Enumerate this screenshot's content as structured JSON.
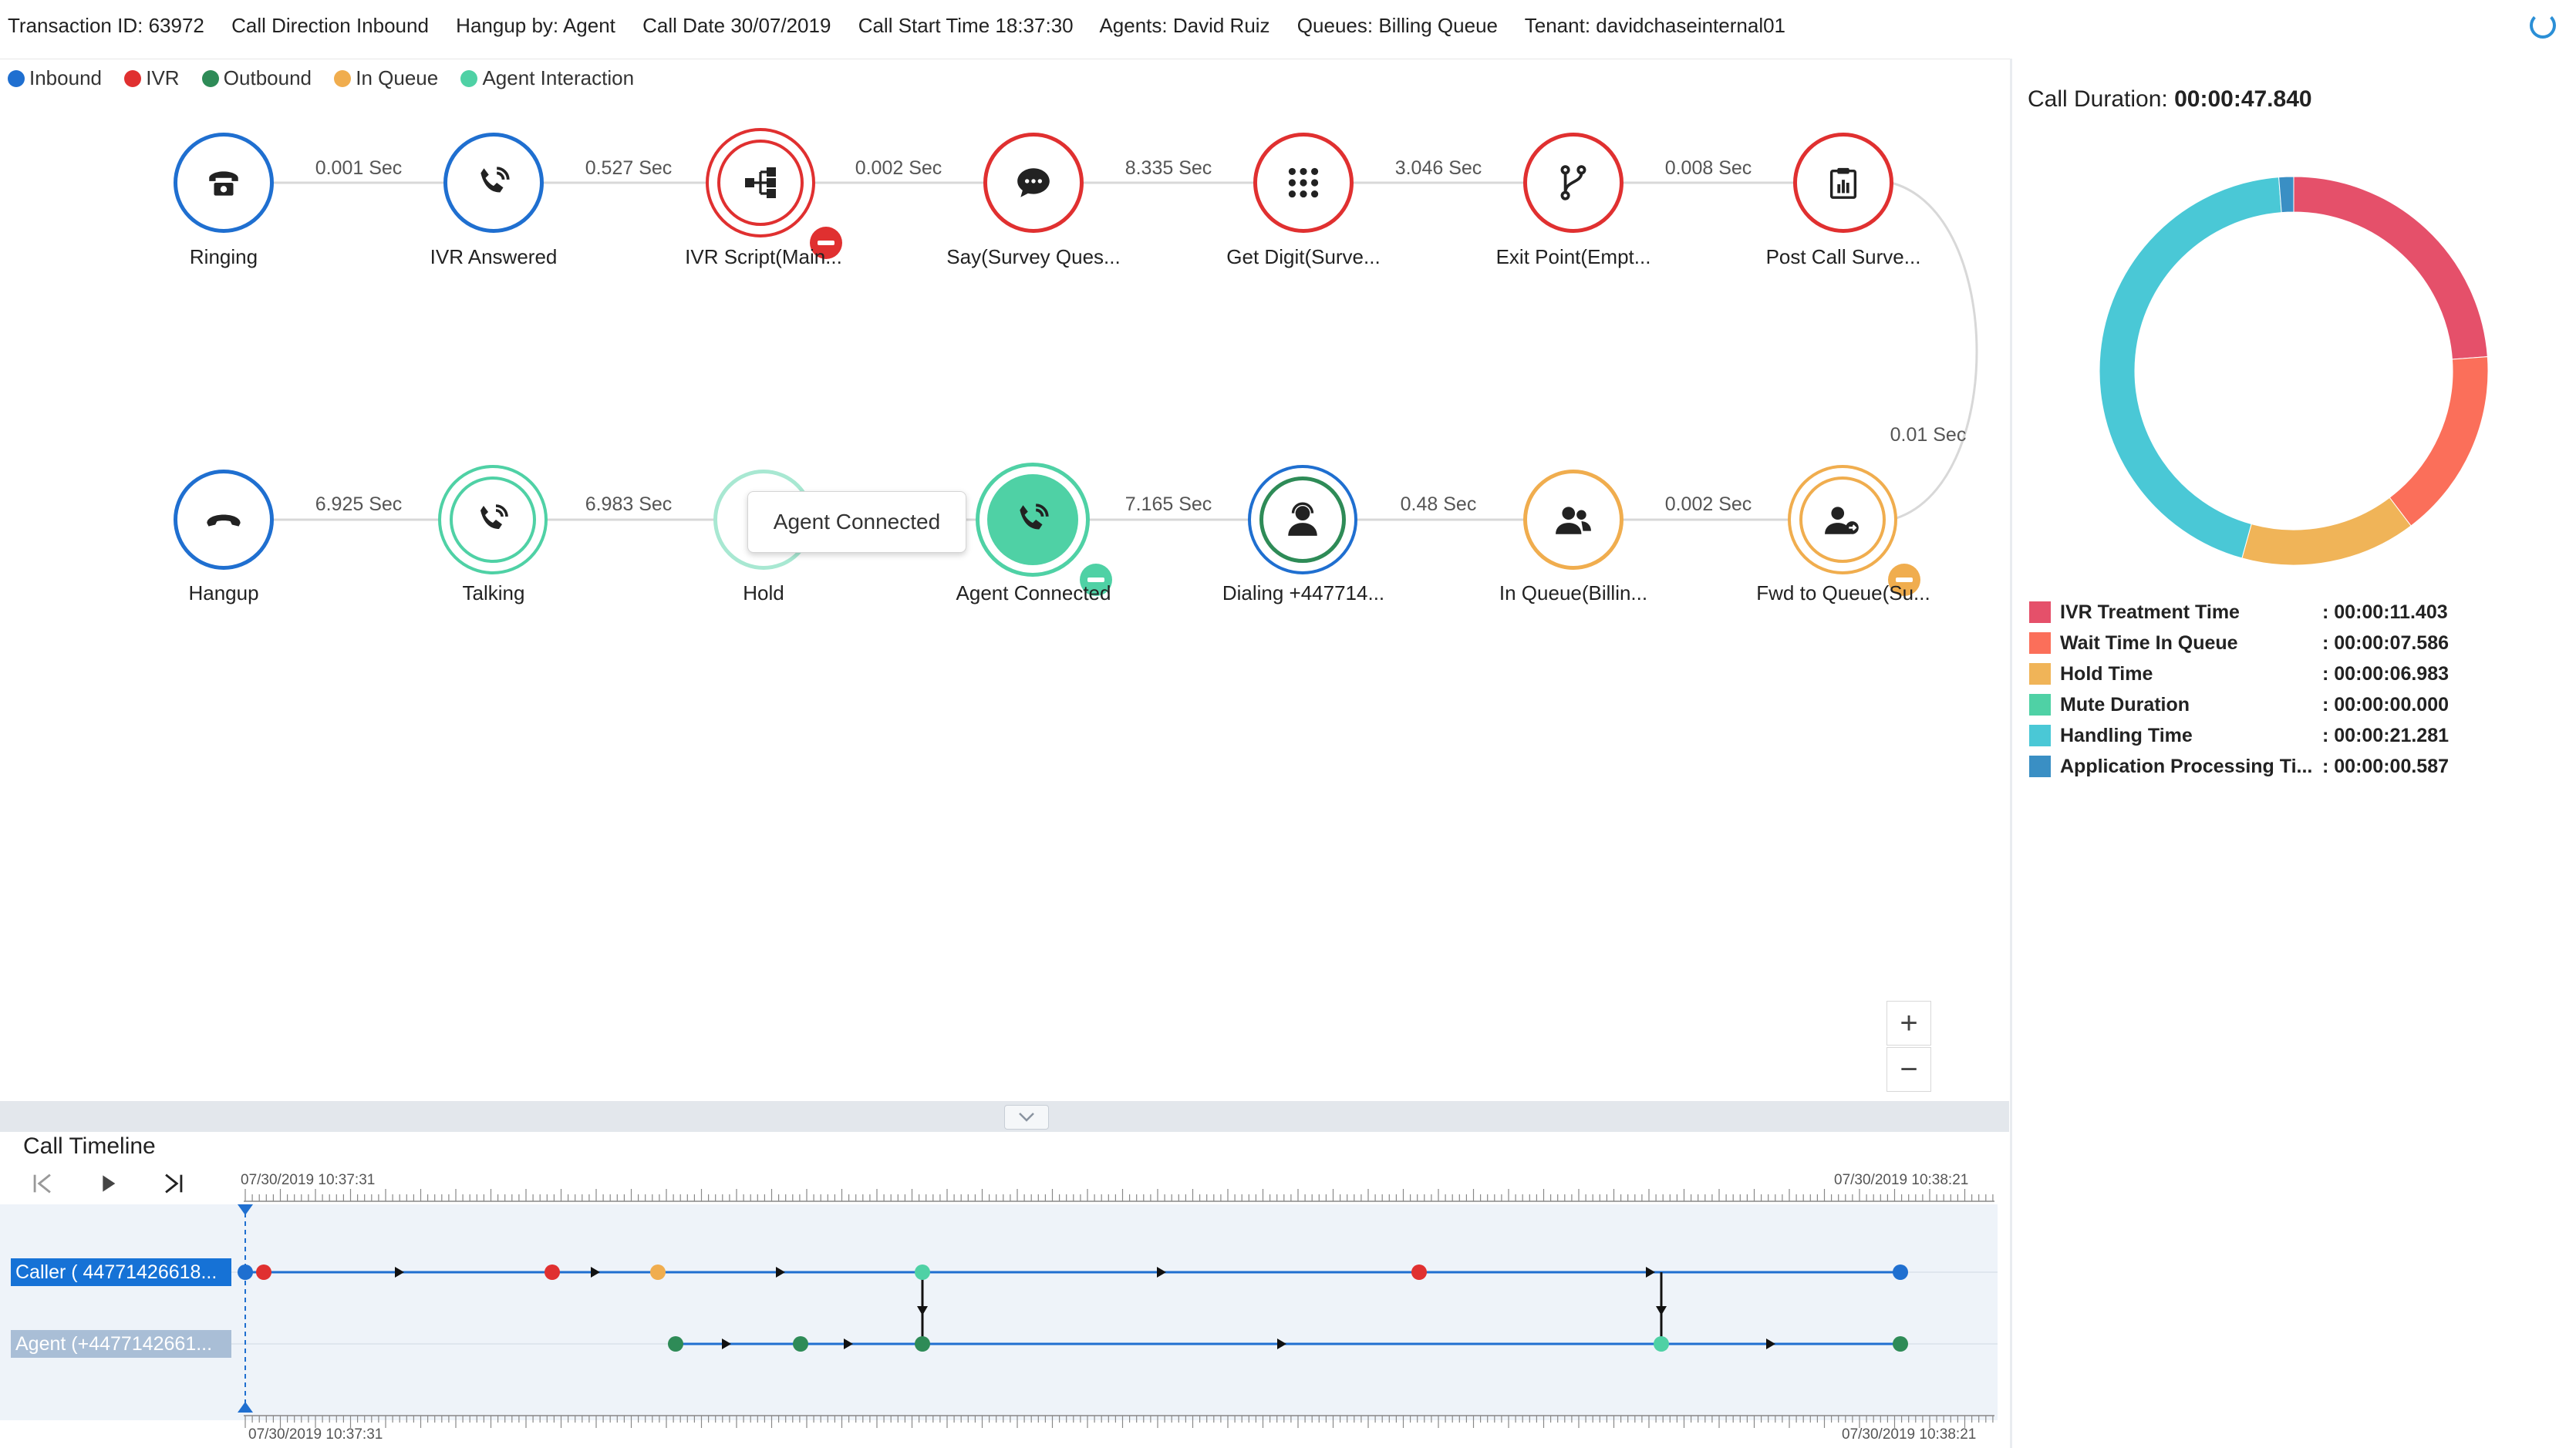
{
  "header": {
    "transaction_label": "Transaction ID:",
    "transaction_id": "63972",
    "direction_label": "Call Direction",
    "direction": "Inbound",
    "hangup_label": "Hangup by:",
    "hangup_by": "Agent",
    "date_label": "Call Date",
    "date": "30/07/2019",
    "start_label": "Call Start Time",
    "start_time": "18:37:30",
    "agents_label": "Agents:",
    "agents": "David Ruiz",
    "queues_label": "Queues:",
    "queues": "Billing Queue",
    "tenant_label": "Tenant:",
    "tenant": "davidchaseinternal01"
  },
  "legend": [
    {
      "label": "Inbound",
      "color": "#1f6fd0"
    },
    {
      "label": "IVR",
      "color": "#e03030"
    },
    {
      "label": "Outbound",
      "color": "#2e8b57"
    },
    {
      "label": "In Queue",
      "color": "#f0ad4e"
    },
    {
      "label": "Agent Interaction",
      "color": "#4fd1a5"
    }
  ],
  "flow": {
    "row1": [
      {
        "label": "Ringing",
        "icon": "telephone-icon",
        "color": "#1f6fd0"
      },
      {
        "label": "IVR Answered",
        "icon": "phone-call-icon",
        "color": "#1f6fd0"
      },
      {
        "label": "IVR Script(Main...",
        "icon": "hierarchy-icon",
        "color": "#e03030"
      },
      {
        "label": "Say(Survey Ques...",
        "icon": "chat-bubble-icon",
        "color": "#e03030"
      },
      {
        "label": "Get Digit(Surve...",
        "icon": "keypad-icon",
        "color": "#e03030"
      },
      {
        "label": "Exit Point(Empt...",
        "icon": "fork-icon",
        "color": "#e03030"
      },
      {
        "label": "Post Call Surve...",
        "icon": "clipboard-chart-icon",
        "color": "#e03030"
      }
    ],
    "row1_edges": [
      "0.001 Sec",
      "0.527 Sec",
      "0.002 Sec",
      "8.335 Sec",
      "3.046 Sec",
      "0.008 Sec"
    ],
    "connector_edge": "0.01 Sec",
    "row2": [
      {
        "label": "Hangup",
        "icon": "hangup-icon",
        "color": "#1f6fd0"
      },
      {
        "label": "Talking",
        "icon": "phone-call-icon",
        "color": "#4fd1a5"
      },
      {
        "label": "Hold",
        "icon": "hold-icon",
        "color": "#4fd1a5"
      },
      {
        "label": "Agent Connected",
        "icon": "phone-call-icon",
        "color": "#4fd1a5"
      },
      {
        "label": "Dialing +447714...",
        "icon": "agent-icon",
        "color": "#2e8b57"
      },
      {
        "label": "In Queue(Billin...",
        "icon": "users-icon",
        "color": "#f0ad4e"
      },
      {
        "label": "Fwd to Queue(Su...",
        "icon": "user-forward-icon",
        "color": "#f0ad4e"
      }
    ],
    "row2_edges": [
      "6.925 Sec",
      "6.983 Sec",
      "",
      "7.165 Sec",
      "0.48 Sec",
      "0.002 Sec"
    ],
    "tooltip": "Agent Connected"
  },
  "zoom": {
    "in": "+",
    "out": "−"
  },
  "timeline": {
    "title": "Call Timeline",
    "start_label": "07/30/2019 10:37:31",
    "end_label": "07/30/2019 10:38:21",
    "lanes": [
      {
        "label": "Caller ( 44771426618..."
      },
      {
        "label": "Agent (+4477142661..."
      }
    ]
  },
  "duration": {
    "label": "Call Duration:",
    "value": "00:00:47.840",
    "items": [
      {
        "name": "IVR Treatment Time",
        "value": ": 00:00:11.403",
        "seconds": 11.403,
        "color": "#e5506a"
      },
      {
        "name": "Wait Time In Queue",
        "value": ": 00:00:07.586",
        "seconds": 7.586,
        "color": "#fb6f5a"
      },
      {
        "name": "Hold Time",
        "value": ": 00:00:06.983",
        "seconds": 6.983,
        "color": "#f0b458"
      },
      {
        "name": "Mute Duration",
        "value": ": 00:00:00.000",
        "seconds": 0.0,
        "color": "#4fd1a5"
      },
      {
        "name": "Handling Time",
        "value": ": 00:00:21.281",
        "seconds": 21.281,
        "color": "#4ac8d6"
      },
      {
        "name": "Application Processing Ti...",
        "value": ": 00:00:00.587",
        "seconds": 0.587,
        "color": "#3a8fc4"
      }
    ]
  }
}
